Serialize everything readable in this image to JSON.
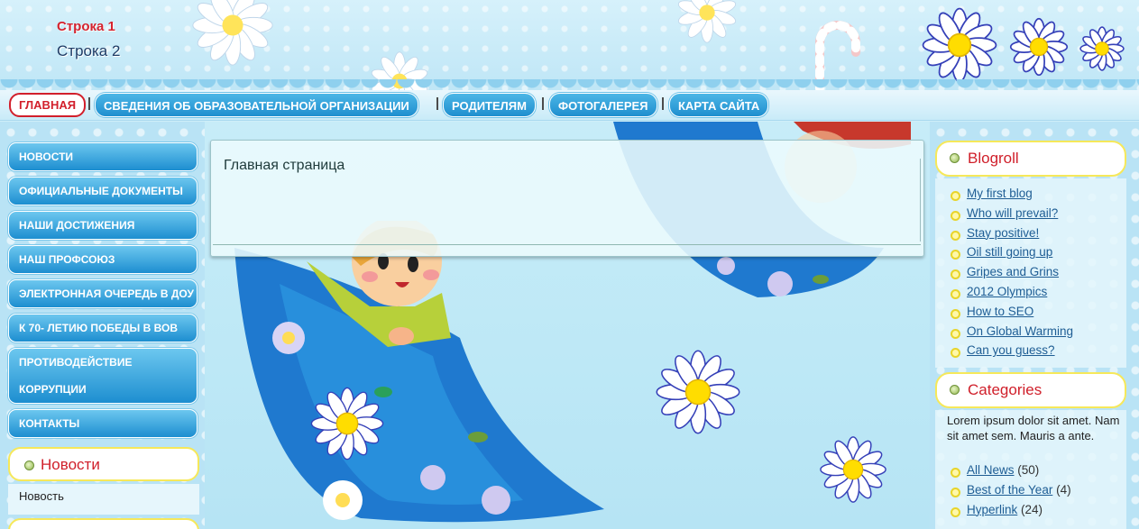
{
  "header": {
    "line1": "Строка 1",
    "line2": "Строка 2"
  },
  "topnav": {
    "items": [
      {
        "label": "ГЛАВНАЯ",
        "active": true
      },
      {
        "label": "СВЕДЕНИЯ ОБ ОБРАЗОВАТЕЛЬНОЙ ОРГАНИЗАЦИИ"
      },
      {
        "label": "РОДИТЕЛЯМ"
      },
      {
        "label": "ФОТОГАЛЕРЕЯ"
      },
      {
        "label": "КАРТА САЙТА"
      }
    ]
  },
  "sidebar": {
    "items": [
      {
        "label": "НОВОСТИ"
      },
      {
        "label": "ОФИЦИАЛЬНЫЕ ДОКУМЕНТЫ"
      },
      {
        "label": "НАШИ ДОСТИЖЕНИЯ"
      },
      {
        "label": "НАШ ПРОФСОЮЗ"
      },
      {
        "label": "ЭЛЕКТРОННАЯ ОЧЕРЕДЬ В ДОУ"
      },
      {
        "label": "К 70- ЛЕТИЮ ПОБЕДЫ В ВОВ"
      },
      {
        "label_line1": "ПРОТИВОДЕЙСТВИЕ",
        "label_line2": "КОРРУПЦИИ"
      },
      {
        "label": "КОНТАКТЫ"
      }
    ],
    "news_box": {
      "title": "Новости",
      "item": "Новость"
    }
  },
  "content": {
    "title": "Главная страница"
  },
  "blogroll": {
    "title": "Blogroll",
    "links": [
      "My first blog",
      "Who will prevail?",
      "Stay positive!",
      "Oil still going up",
      "Gripes and Grins",
      "2012 Olympics",
      "How to SEO",
      "On Global Warming",
      "Can you guess?"
    ]
  },
  "categories": {
    "title": "Categories",
    "description": "Lorem ipsum dolor sit amet. Nam sit amet sem. Mauris a ante.",
    "items": [
      {
        "label": "All News",
        "count": "(50)"
      },
      {
        "label": "Best of the Year",
        "count": "(4)"
      },
      {
        "label": "Hyperlink",
        "count": "(24)"
      }
    ]
  },
  "colors": {
    "accent_red": "#d01f2a",
    "nav_blue": "#1f8fcf",
    "box_yellow": "#f6e85a"
  },
  "icons": [
    "daisy-icon",
    "bullet-icon"
  ]
}
